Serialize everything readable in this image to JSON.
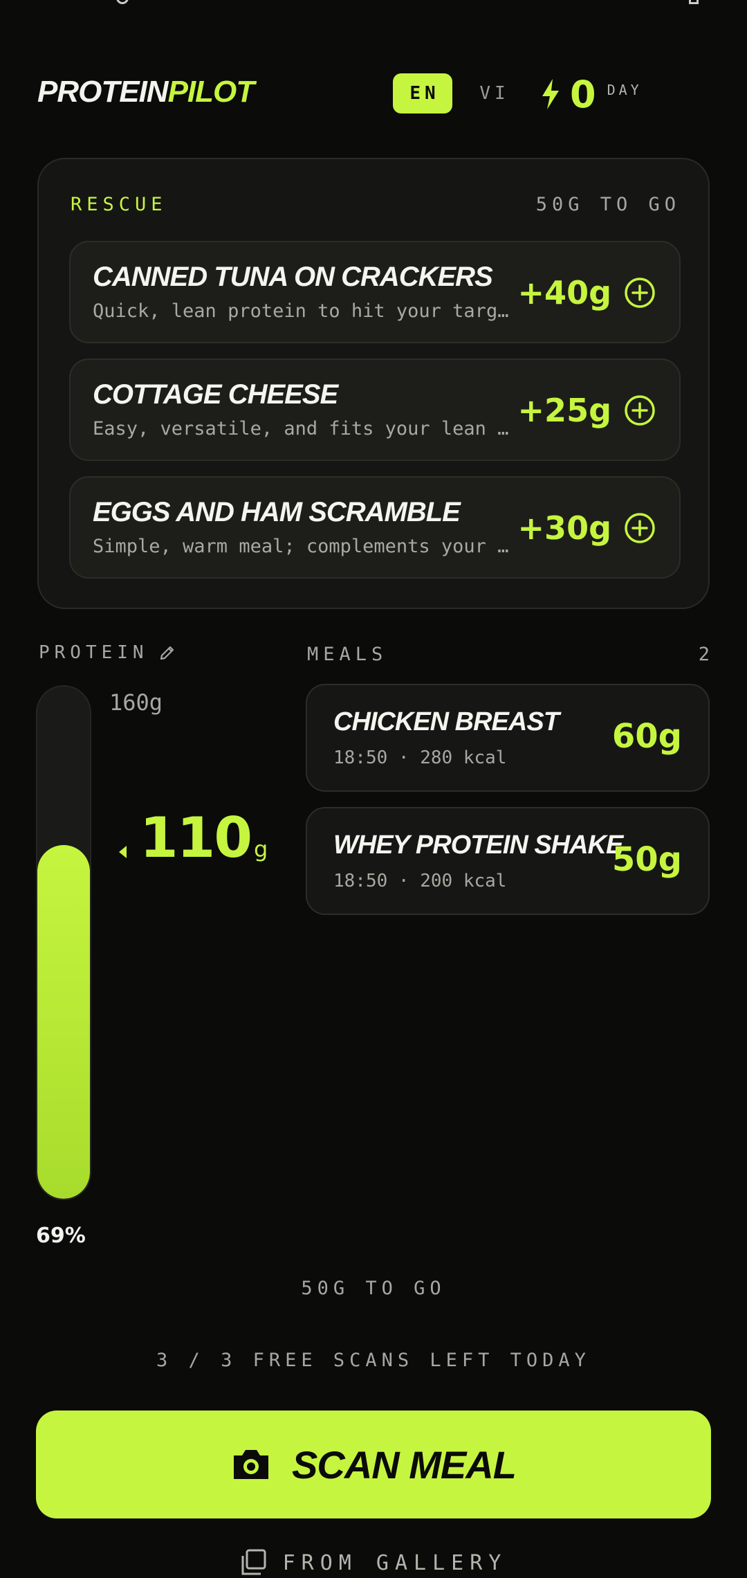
{
  "brand": {
    "part1": "PROTEIN",
    "part2": "PILOT"
  },
  "language": {
    "active": "EN",
    "inactive": "VI"
  },
  "streak": {
    "count": "0",
    "unit": "DAY"
  },
  "rescue": {
    "title": "RESCUE",
    "to_go": "50G TO GO",
    "suggestions": [
      {
        "name": "CANNED TUNA ON CRACKERS",
        "desc": "Quick, lean protein to hit your target fast.",
        "amount": "+40g"
      },
      {
        "name": "COTTAGE CHEESE",
        "desc": "Easy, versatile, and fits your lean goals.",
        "amount": "+25g"
      },
      {
        "name": "EGGS AND HAM SCRAMBLE",
        "desc": "Simple, warm meal; complements your day.",
        "amount": "+30g"
      }
    ]
  },
  "protein": {
    "label": "PROTEIN",
    "goal": "160g",
    "current": "110",
    "current_unit": "g",
    "percent_text": "69%",
    "progress": 0.69
  },
  "meals": {
    "label": "MEALS",
    "count": "2",
    "items": [
      {
        "name": "CHICKEN BREAST",
        "meta": "18:50 · 280 kcal",
        "grams": "60g"
      },
      {
        "name": "WHEY PROTEIN SHAKE",
        "meta": "18:50 · 200 kcal",
        "grams": "50g"
      }
    ]
  },
  "footer": {
    "to_go": "50G TO GO",
    "scans_left": "3 / 3 FREE SCANS LEFT TODAY",
    "scan_button": "SCAN MEAL",
    "gallery": "FROM GALLERY"
  },
  "icons": {
    "streak": "bolt-icon",
    "add": "plus-circle-icon",
    "edit": "pencil-icon",
    "camera": "camera-icon",
    "gallery": "gallery-icon"
  },
  "colors": {
    "accent": "#c6f53f",
    "background": "#0b0b0a",
    "card": "#1d1e1a"
  }
}
